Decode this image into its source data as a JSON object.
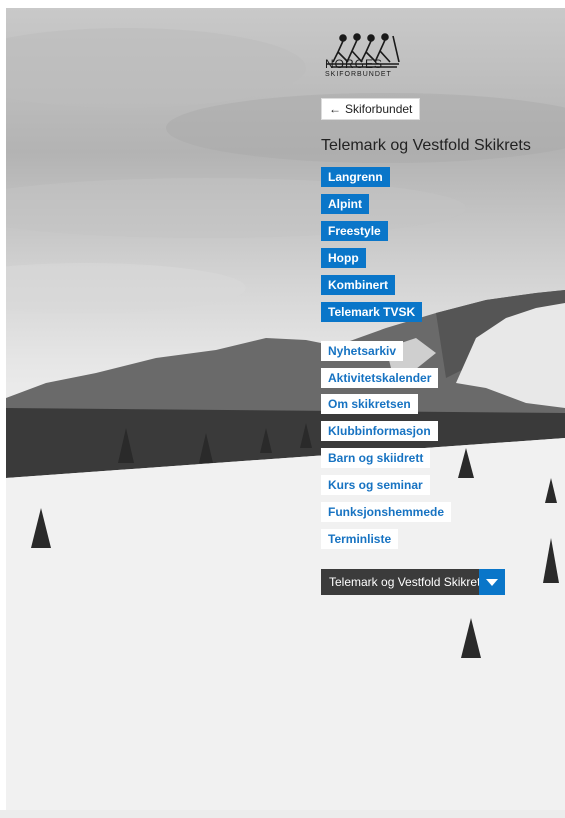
{
  "logo": {
    "name": "NORGES",
    "sub": "SKIFORBUNDET"
  },
  "back_link": {
    "arrow": "←",
    "label": "Skiforbundet"
  },
  "region_title": "Telemark og Vestfold Skikrets",
  "disciplines": [
    "Langrenn",
    "Alpint",
    "Freestyle",
    "Hopp",
    "Kombinert",
    "Telemark TVSK"
  ],
  "submenu": [
    "Nyhetsarkiv",
    "Aktivitetskalender",
    "Om skikretsen",
    "Klubbinformasjon",
    "Barn og skiidrett",
    "Kurs og seminar",
    "Funksjonshemmede",
    "Terminliste"
  ],
  "region_select": {
    "value": "Telemark og Vestfold Skikrets"
  },
  "colors": {
    "accent": "#0a76c9",
    "dark": "#3b3b3b"
  }
}
